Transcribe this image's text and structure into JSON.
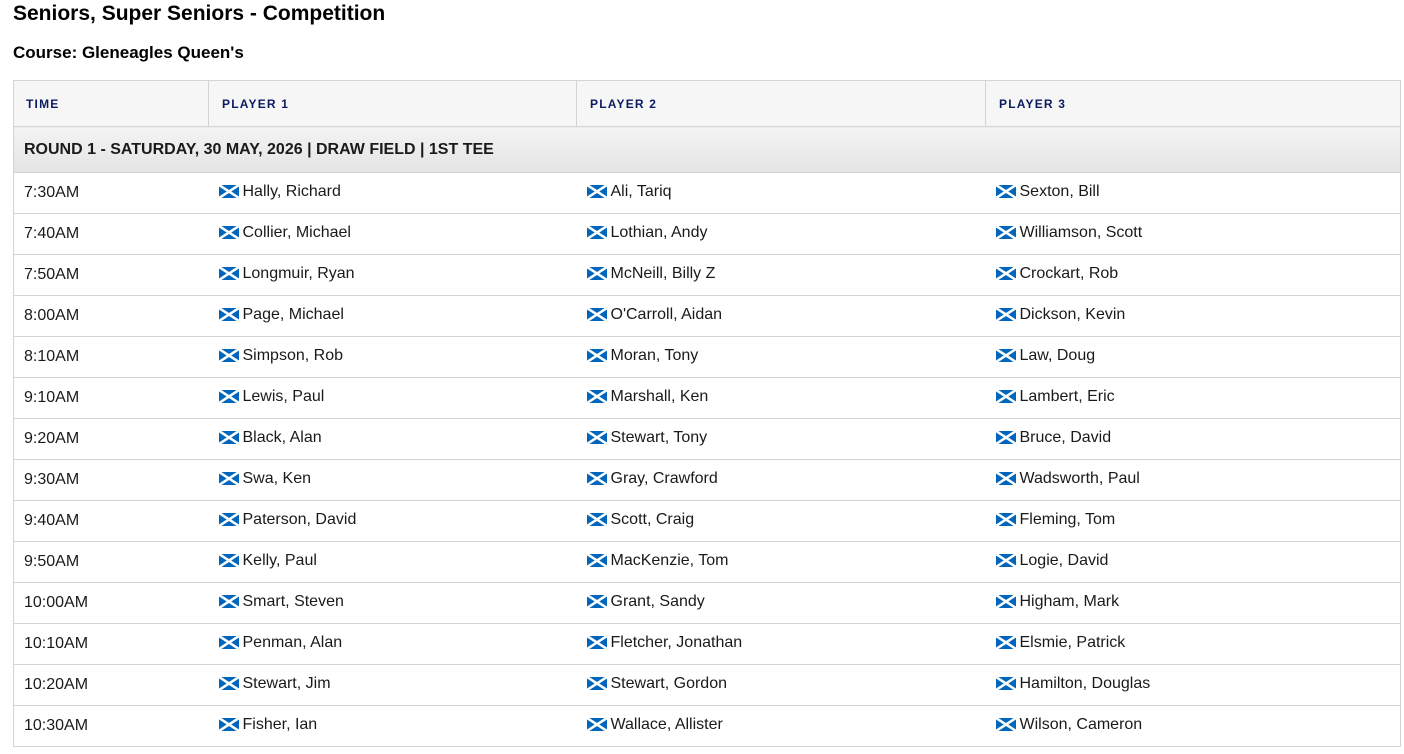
{
  "header": {
    "title": "Seniors, Super Seniors - Competition",
    "course": "Course: Gleneagles Queen's"
  },
  "table": {
    "columns": [
      "TIME",
      "PLAYER 1",
      "PLAYER 2",
      "PLAYER 3"
    ],
    "round_label": "ROUND 1 - SATURDAY, 30 MAY, 2026 | DRAW FIELD | 1ST TEE",
    "flag_icon": "scotland-flag-icon",
    "flag_colors": {
      "field": "#0065bd",
      "saltire": "#ffffff"
    },
    "rows": [
      {
        "time": "7:30AM",
        "players": [
          "Hally, Richard",
          "Ali, Tariq",
          "Sexton, Bill"
        ]
      },
      {
        "time": "7:40AM",
        "players": [
          "Collier, Michael",
          "Lothian, Andy",
          "Williamson, Scott"
        ]
      },
      {
        "time": "7:50AM",
        "players": [
          "Longmuir, Ryan",
          "McNeill, Billy Z",
          "Crockart, Rob"
        ]
      },
      {
        "time": "8:00AM",
        "players": [
          "Page, Michael",
          "O'Carroll, Aidan",
          "Dickson, Kevin"
        ]
      },
      {
        "time": "8:10AM",
        "players": [
          "Simpson, Rob",
          "Moran, Tony",
          "Law, Doug"
        ]
      },
      {
        "time": "9:10AM",
        "players": [
          "Lewis, Paul",
          "Marshall, Ken",
          "Lambert, Eric"
        ]
      },
      {
        "time": "9:20AM",
        "players": [
          "Black, Alan",
          "Stewart, Tony",
          "Bruce, David"
        ]
      },
      {
        "time": "9:30AM",
        "players": [
          "Swa, Ken",
          "Gray, Crawford",
          "Wadsworth, Paul"
        ]
      },
      {
        "time": "9:40AM",
        "players": [
          "Paterson, David",
          "Scott, Craig",
          "Fleming, Tom"
        ]
      },
      {
        "time": "9:50AM",
        "players": [
          "Kelly, Paul",
          "MacKenzie, Tom",
          "Logie, David"
        ]
      },
      {
        "time": "10:00AM",
        "players": [
          "Smart, Steven",
          "Grant, Sandy",
          "Higham, Mark"
        ]
      },
      {
        "time": "10:10AM",
        "players": [
          "Penman, Alan",
          "Fletcher, Jonathan",
          "Elsmie, Patrick"
        ]
      },
      {
        "time": "10:20AM",
        "players": [
          "Stewart, Jim",
          "Stewart, Gordon",
          "Hamilton, Douglas"
        ]
      },
      {
        "time": "10:30AM",
        "players": [
          "Fisher, Ian",
          "Wallace, Allister",
          "Wilson, Cameron"
        ]
      }
    ]
  }
}
